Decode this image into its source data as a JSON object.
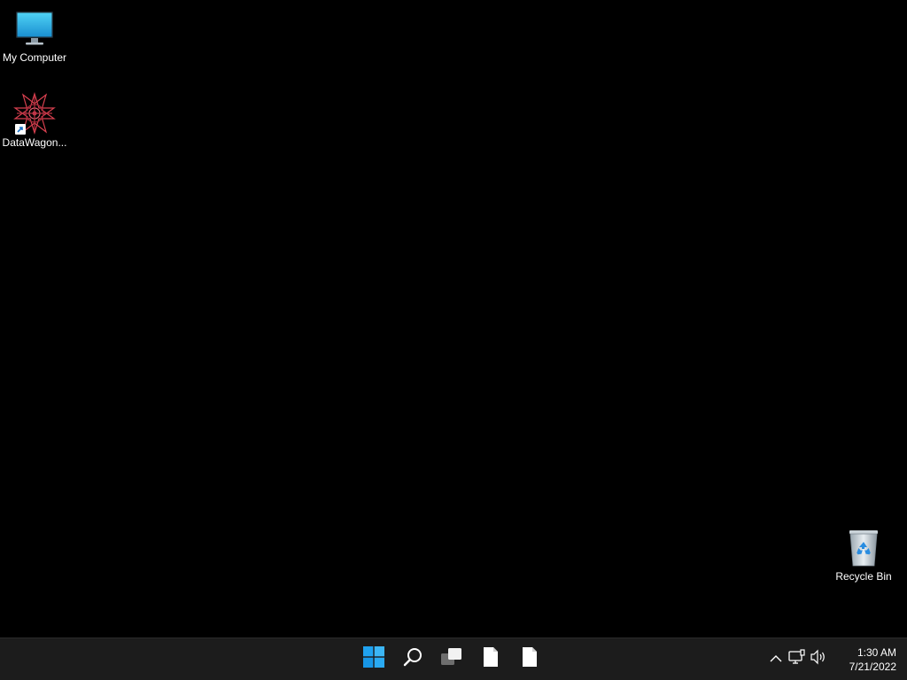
{
  "desktop": {
    "background_color": "#000000",
    "icons": [
      {
        "label": "My Computer",
        "icon": "monitor-icon"
      },
      {
        "label": "DataWagon...",
        "icon": "datawagon-app-icon",
        "shortcut": true
      },
      {
        "label": "Recycle Bin",
        "icon": "recycle-bin-icon"
      }
    ]
  },
  "taskbar": {
    "background_color": "#1c1c1c",
    "pinned": [
      {
        "name": "start-button",
        "icon": "windows-logo-icon"
      },
      {
        "name": "search-button",
        "icon": "search-icon"
      },
      {
        "name": "task-view-button",
        "icon": "task-view-icon"
      },
      {
        "name": "taskbar-app-1",
        "icon": "blank-file-icon"
      },
      {
        "name": "taskbar-app-2",
        "icon": "blank-file-icon"
      }
    ],
    "tray": {
      "icons": [
        "chevron-up-icon",
        "network-icon",
        "volume-icon"
      ],
      "time": "1:30 AM",
      "date": "7/21/2022"
    }
  },
  "colors": {
    "accent": "#0078d4",
    "monitor_blue": "#2bb3e8",
    "datawagon_red": "#d8404f"
  }
}
